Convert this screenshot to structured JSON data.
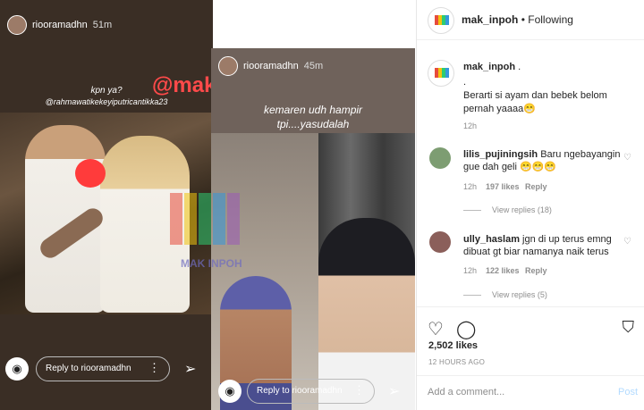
{
  "story1": {
    "username": "riooramadhn",
    "time": "51m",
    "caption_line1": "kpn ya?",
    "caption_line2": "@rahmawatikekeyiputricantikka23",
    "watermark": "@mak_inpoh",
    "reply_placeholder": "Reply to riooramadhn"
  },
  "story2": {
    "username": "riooramadhn",
    "time": "45m",
    "caption_line1": "kemaren udh hampir",
    "caption_line2": "tpi....yasudalah",
    "watermark": "MAK INPOH",
    "reply_placeholder": "Reply to riooramadhn"
  },
  "post": {
    "header": {
      "username": "mak_inpoh",
      "separator": "•",
      "follow_label": "Following"
    },
    "caption": {
      "username": "mak_inpoh",
      "tail": ".",
      "dot": ".",
      "text": "Berarti si ayam dan bebek belom pernah yaaaa😁",
      "time": "12h"
    },
    "comments": [
      {
        "username": "lilis_pujiningsih",
        "text": "Baru ngebayangin gue dah geli 😁😁😁",
        "time": "12h",
        "likes": "197 likes",
        "reply_label": "Reply",
        "view_replies": "View replies (18)"
      },
      {
        "username": "ully_haslam",
        "text": "jgn di up terus emng dibuat gt biar namanya naik terus",
        "time": "12h",
        "likes": "122 likes",
        "reply_label": "Reply",
        "view_replies": "View replies (5)"
      }
    ],
    "likes": "2,502 likes",
    "time_ago": "12 HOURS AGO",
    "comment_placeholder": "Add a comment...",
    "post_label": "Post"
  },
  "colors": {
    "watermark_red": "#ff4a4a",
    "post_disabled": "#b3dbff",
    "muted": "#8e8e8e"
  },
  "icons": [
    "camera-icon",
    "more-icon",
    "send-icon",
    "heart-icon",
    "comment-icon",
    "bookmark-icon"
  ]
}
